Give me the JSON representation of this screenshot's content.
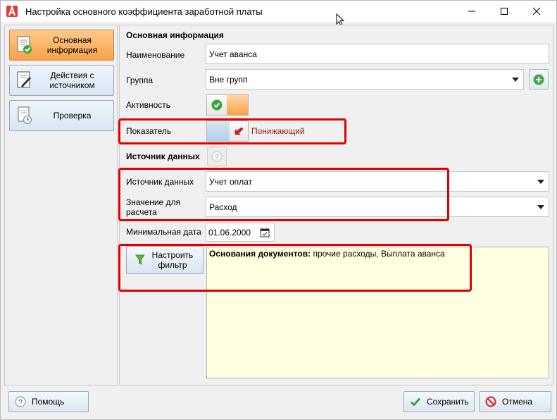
{
  "window": {
    "title": "Настройка основного коэффициента заработной платы"
  },
  "sidebar": {
    "items": [
      {
        "label": "Основная информация",
        "active": true,
        "icon": "document-check-icon"
      },
      {
        "label": "Действия с источником",
        "active": false,
        "icon": "document-edit-icon"
      },
      {
        "label": "Проверка",
        "active": false,
        "icon": "document-clock-icon"
      }
    ]
  },
  "main": {
    "section_basic": "Основная информация",
    "name_label": "Наименование",
    "name_value": "Учет аванса",
    "group_label": "Группа",
    "group_value": "Вне групп",
    "active_label": "Активность",
    "indicator_label": "Показатель",
    "indicator_value": "Понижающий",
    "section_source": "Источник данных",
    "source_label": "Источник данных",
    "source_value": "Учет оплат",
    "calc_label": "Значение для расчета",
    "calc_value": "Расход",
    "min_date_label": "Минимальная дата",
    "min_date_value": "01.06.2000",
    "filter_button": "Настроить фильтр",
    "filter_bold": "Основания документов:",
    "filter_text": " прочие расходы, Выплата аванса"
  },
  "footer": {
    "help_label": "Помощь",
    "save_label": "Сохранить",
    "cancel_label": "Отмена"
  },
  "colors": {
    "accent_active": "#f7a24a",
    "highlight_box": "#e00000",
    "memo_bg": "#ffffe1",
    "indicator_text": "#8b1a1a"
  }
}
